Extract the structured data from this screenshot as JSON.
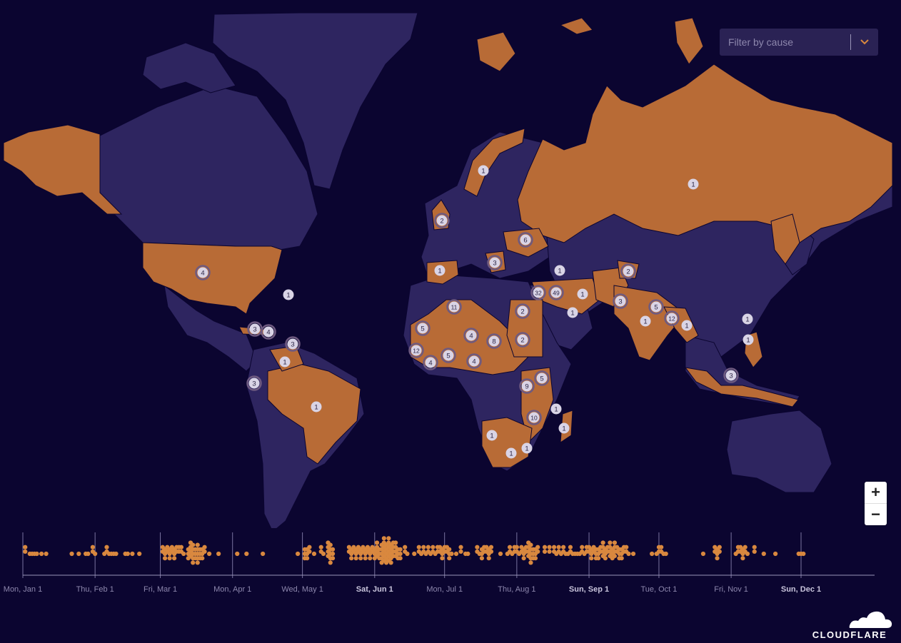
{
  "filter": {
    "placeholder": "Filter by cause"
  },
  "zoom": {
    "in_label": "+",
    "out_label": "−"
  },
  "colors": {
    "background": "#0b0530",
    "land": "#2e2560",
    "affected": "#b86b36",
    "marker": "#d9d4e6",
    "border": "#0b0530"
  },
  "markers": [
    {
      "label": "1",
      "place": "Norway"
    },
    {
      "label": "1",
      "place": "Russia"
    },
    {
      "label": "2",
      "place": "United Kingdom"
    },
    {
      "label": "6",
      "place": "Ukraine"
    },
    {
      "label": "3",
      "place": "Balkans"
    },
    {
      "label": "1",
      "place": "Spain"
    },
    {
      "label": "4",
      "place": "United States"
    },
    {
      "label": "1",
      "place": "Atlantic"
    },
    {
      "label": "1",
      "place": "Azerbaijan"
    },
    {
      "label": "2",
      "place": "Kashmir"
    },
    {
      "label": "32",
      "place": "Syria"
    },
    {
      "label": "49",
      "place": "Iraq"
    },
    {
      "label": "1",
      "place": "Iran"
    },
    {
      "label": "3",
      "place": "Pakistan"
    },
    {
      "label": "5",
      "place": "Nepal"
    },
    {
      "label": "1",
      "place": "Gulf"
    },
    {
      "label": "11",
      "place": "Algeria"
    },
    {
      "label": "2",
      "place": "Egypt"
    },
    {
      "label": "1",
      "place": "India"
    },
    {
      "label": "12",
      "place": "Bangladesh"
    },
    {
      "label": "1",
      "place": "Myanmar"
    },
    {
      "label": "1",
      "place": "Taiwan"
    },
    {
      "label": "1",
      "place": "Philippines"
    },
    {
      "label": "3",
      "place": "Cuba"
    },
    {
      "label": "4",
      "place": "Haiti"
    },
    {
      "label": "3",
      "place": "Antilles"
    },
    {
      "label": "5",
      "place": "Mauritania"
    },
    {
      "label": "4",
      "place": "Niger"
    },
    {
      "label": "8",
      "place": "Chad"
    },
    {
      "label": "2",
      "place": "Sudan"
    },
    {
      "label": "12",
      "place": "Guinea"
    },
    {
      "label": "5",
      "place": "Ghana"
    },
    {
      "label": "4",
      "place": "Liberia"
    },
    {
      "label": "4",
      "place": "Cameroon"
    },
    {
      "label": "1",
      "place": "Venezuela"
    },
    {
      "label": "3",
      "place": "Ecuador"
    },
    {
      "label": "1",
      "place": "Brazil"
    },
    {
      "label": "5",
      "place": "Kenya"
    },
    {
      "label": "9",
      "place": "Tanzania"
    },
    {
      "label": "10",
      "place": "Mozambique"
    },
    {
      "label": "1",
      "place": "Comoros"
    },
    {
      "label": "1",
      "place": "Madagascar"
    },
    {
      "label": "1",
      "place": "Namibia"
    },
    {
      "label": "1",
      "place": "South Africa"
    },
    {
      "label": "1",
      "place": "Eswatini"
    },
    {
      "label": "3",
      "place": "Indonesia"
    }
  ],
  "timeline": {
    "ticks": [
      {
        "label": "Mon, Jan 1",
        "bold": false
      },
      {
        "label": "Thu, Feb 1",
        "bold": false
      },
      {
        "label": "Fri, Mar 1",
        "bold": false
      },
      {
        "label": "Mon, Apr 1",
        "bold": false
      },
      {
        "label": "Wed, May 1",
        "bold": false
      },
      {
        "label": "Sat, Jun 1",
        "bold": true
      },
      {
        "label": "Mon, Jul 1",
        "bold": false
      },
      {
        "label": "Thu, Aug 1",
        "bold": false
      },
      {
        "label": "Sun, Sep 1",
        "bold": true
      },
      {
        "label": "Tue, Oct 1",
        "bold": false
      },
      {
        "label": "Fri, Nov 1",
        "bold": false
      },
      {
        "label": "Sun, Dec 1",
        "bold": true
      }
    ],
    "events_by_day": [
      [
        1,
        2
      ],
      [
        3,
        1
      ],
      [
        4,
        1
      ],
      [
        5,
        1
      ],
      [
        6,
        1
      ],
      [
        8,
        1
      ],
      [
        10,
        1
      ],
      [
        21,
        1
      ],
      [
        24,
        1
      ],
      [
        27,
        1
      ],
      [
        28,
        1
      ],
      [
        30,
        2
      ],
      [
        31,
        1
      ],
      [
        35,
        1
      ],
      [
        36,
        2
      ],
      [
        37,
        1
      ],
      [
        38,
        1
      ],
      [
        39,
        1
      ],
      [
        40,
        1
      ],
      [
        44,
        1
      ],
      [
        45,
        1
      ],
      [
        47,
        1
      ],
      [
        50,
        1
      ],
      [
        60,
        2
      ],
      [
        61,
        3
      ],
      [
        62,
        2
      ],
      [
        63,
        3
      ],
      [
        64,
        2
      ],
      [
        65,
        3
      ],
      [
        66,
        2
      ],
      [
        67,
        2
      ],
      [
        68,
        2
      ],
      [
        69,
        1
      ],
      [
        71,
        3
      ],
      [
        72,
        4
      ],
      [
        73,
        5
      ],
      [
        74,
        3
      ],
      [
        75,
        5
      ],
      [
        76,
        3
      ],
      [
        77,
        3
      ],
      [
        78,
        2
      ],
      [
        80,
        1
      ],
      [
        84,
        1
      ],
      [
        92,
        1
      ],
      [
        96,
        1
      ],
      [
        103,
        1
      ],
      [
        118,
        1
      ],
      [
        121,
        3
      ],
      [
        122,
        3
      ],
      [
        123,
        2
      ],
      [
        125,
        1
      ],
      [
        128,
        2
      ],
      [
        129,
        1
      ],
      [
        131,
        4
      ],
      [
        132,
        5
      ],
      [
        133,
        3
      ],
      [
        140,
        2
      ],
      [
        141,
        3
      ],
      [
        142,
        2
      ],
      [
        143,
        3
      ],
      [
        144,
        2
      ],
      [
        145,
        3
      ],
      [
        146,
        2
      ],
      [
        147,
        3
      ],
      [
        148,
        2
      ],
      [
        149,
        3
      ],
      [
        150,
        2
      ],
      [
        151,
        3
      ],
      [
        152,
        4
      ],
      [
        153,
        3
      ],
      [
        154,
        5
      ],
      [
        155,
        6
      ],
      [
        156,
        5
      ],
      [
        157,
        6
      ],
      [
        158,
        5
      ],
      [
        159,
        4
      ],
      [
        160,
        4
      ],
      [
        161,
        3
      ],
      [
        162,
        3
      ],
      [
        164,
        2
      ],
      [
        165,
        1
      ],
      [
        168,
        1
      ],
      [
        170,
        2
      ],
      [
        171,
        1
      ],
      [
        172,
        2
      ],
      [
        173,
        1
      ],
      [
        174,
        2
      ],
      [
        175,
        1
      ],
      [
        176,
        2
      ],
      [
        177,
        1
      ],
      [
        178,
        2
      ],
      [
        179,
        2
      ],
      [
        180,
        3
      ],
      [
        181,
        2
      ],
      [
        182,
        2
      ],
      [
        183,
        3
      ],
      [
        184,
        1
      ],
      [
        186,
        1
      ],
      [
        188,
        2
      ],
      [
        190,
        1
      ],
      [
        191,
        1
      ],
      [
        195,
        2
      ],
      [
        196,
        1
      ],
      [
        197,
        3
      ],
      [
        198,
        2
      ],
      [
        199,
        2
      ],
      [
        200,
        3
      ],
      [
        201,
        2
      ],
      [
        205,
        1
      ],
      [
        208,
        1
      ],
      [
        209,
        2
      ],
      [
        210,
        1
      ],
      [
        211,
        2
      ],
      [
        212,
        2
      ],
      [
        213,
        1
      ],
      [
        214,
        2
      ],
      [
        215,
        3
      ],
      [
        216,
        2
      ],
      [
        217,
        4
      ],
      [
        218,
        5
      ],
      [
        219,
        3
      ],
      [
        220,
        3
      ],
      [
        221,
        2
      ],
      [
        224,
        2
      ],
      [
        226,
        2
      ],
      [
        228,
        2
      ],
      [
        229,
        1
      ],
      [
        230,
        2
      ],
      [
        231,
        1
      ],
      [
        232,
        2
      ],
      [
        233,
        1
      ],
      [
        234,
        1
      ],
      [
        235,
        2
      ],
      [
        236,
        1
      ],
      [
        237,
        1
      ],
      [
        238,
        1
      ],
      [
        239,
        1
      ],
      [
        240,
        2
      ],
      [
        241,
        1
      ],
      [
        242,
        2
      ],
      [
        243,
        2
      ],
      [
        244,
        3
      ],
      [
        245,
        2
      ],
      [
        246,
        3
      ],
      [
        247,
        3
      ],
      [
        248,
        2
      ],
      [
        249,
        4
      ],
      [
        250,
        3
      ],
      [
        251,
        2
      ],
      [
        252,
        4
      ],
      [
        253,
        3
      ],
      [
        254,
        4
      ],
      [
        255,
        2
      ],
      [
        256,
        3
      ],
      [
        257,
        3
      ],
      [
        258,
        2
      ],
      [
        259,
        2
      ],
      [
        260,
        1
      ],
      [
        262,
        1
      ],
      [
        270,
        1
      ],
      [
        272,
        1
      ],
      [
        273,
        2
      ],
      [
        274,
        2
      ],
      [
        275,
        1
      ],
      [
        276,
        1
      ],
      [
        292,
        1
      ],
      [
        297,
        2
      ],
      [
        298,
        3
      ],
      [
        299,
        2
      ],
      [
        306,
        1
      ],
      [
        307,
        2
      ],
      [
        308,
        2
      ],
      [
        309,
        3
      ],
      [
        310,
        2
      ],
      [
        311,
        1
      ],
      [
        314,
        2
      ],
      [
        318,
        1
      ],
      [
        323,
        1
      ],
      [
        333,
        1
      ],
      [
        334,
        1
      ],
      [
        335,
        1
      ]
    ]
  }
}
